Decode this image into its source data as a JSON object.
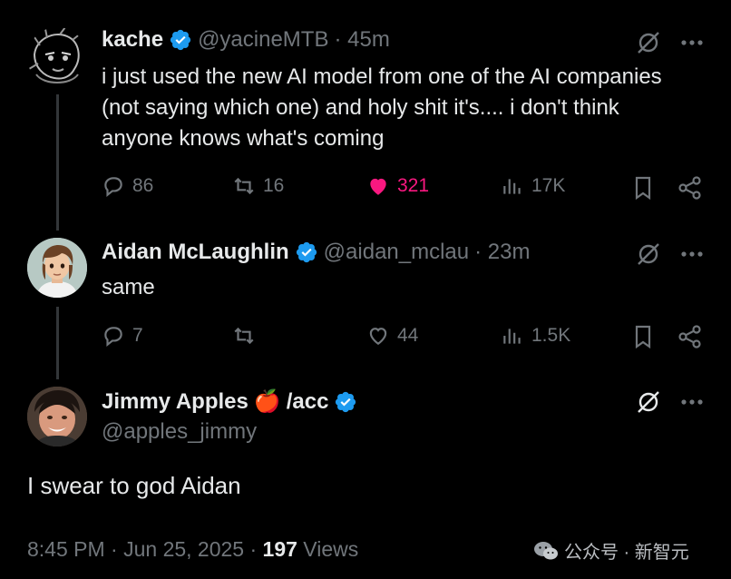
{
  "colors": {
    "background": "#000000",
    "text": "#e7e9ea",
    "muted": "#71767b",
    "verified": "#1d9bf0",
    "like": "#f91880",
    "thread_line": "#333639"
  },
  "tweets": [
    {
      "name": "kache",
      "handle": "@yacineMTB",
      "time": "· 45m",
      "text": "i just used the new AI model from one of the AI companies (not saying which one) and holy shit it's.... i don't think anyone knows what's coming",
      "replies": "86",
      "retweets": "16",
      "likes": "321",
      "liked": true,
      "views": "17K",
      "avatar_icon": "anime-sketch-avatar"
    },
    {
      "name": "Aidan McLaughlin",
      "handle": "@aidan_mclau",
      "time": "· 23m",
      "text": "same",
      "replies": "7",
      "retweets": "",
      "likes": "44",
      "liked": false,
      "views": "1.5K",
      "avatar_icon": "cartoon-boy-avatar"
    }
  ],
  "main_tweet": {
    "name": "Jimmy Apples",
    "name_emoji": "🍎",
    "name_suffix": "/acc",
    "handle": "@apples_jimmy",
    "text": "I swear to god Aidan",
    "timestamp": "8:45 PM · Jun 25, 2025 · ",
    "view_count": "197",
    "views_label": " Views",
    "avatar_icon": "smiling-man-avatar"
  },
  "watermark": {
    "text": "公众号 · 新智元",
    "icon": "wechat-icon"
  }
}
